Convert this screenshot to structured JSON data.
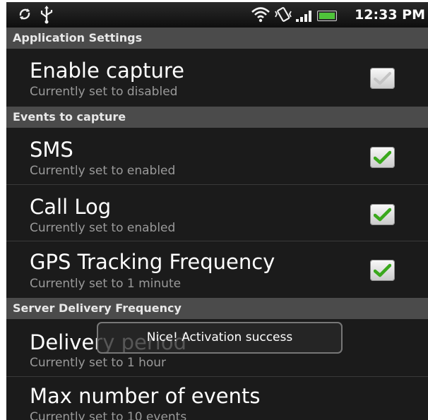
{
  "status_bar": {
    "time": "12:33 PM",
    "icons": [
      "sync-icon",
      "usb-icon",
      "wifi-icon",
      "vibrate-icon",
      "signal-icon",
      "battery-icon"
    ],
    "battery_color": "#4fc43a"
  },
  "sections": {
    "application_settings": "Application Settings",
    "events_to_capture": "Events to capture",
    "server_delivery_frequency": "Server Delivery Frequency"
  },
  "preferences": {
    "enable_capture": {
      "title": "Enable capture",
      "summary": "Currently set to disabled",
      "checked": false
    },
    "sms": {
      "title": "SMS",
      "summary": "Currently set to enabled",
      "checked": true
    },
    "call_log": {
      "title": "Call Log",
      "summary": "Currently set to enabled",
      "checked": true
    },
    "gps_tracking": {
      "title": "GPS Tracking Frequency",
      "summary": "Currently set to 1 minute",
      "checked": true
    },
    "delivery_period": {
      "title": "Delivery period",
      "summary": "Currently set to 1 hour"
    },
    "max_events": {
      "title": "Max number of events",
      "summary": "Currently set to 10 events"
    }
  },
  "toast": {
    "message": "Nice! Activation success"
  },
  "colors": {
    "check_green": "#3aa81c",
    "check_disabled": "#c4c4c4",
    "category_bg": "#4b4b4b",
    "screen_bg": "#1b1b1b"
  }
}
